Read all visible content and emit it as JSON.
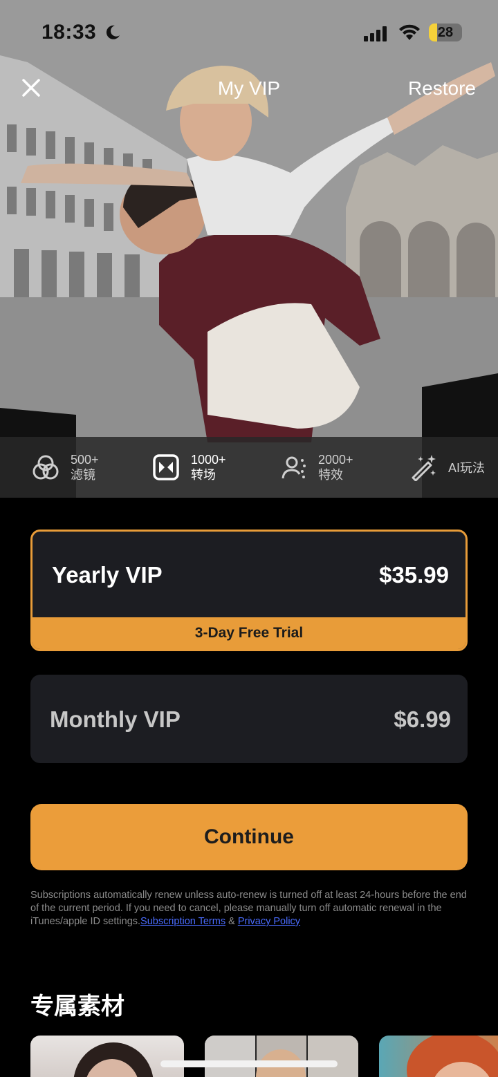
{
  "status_bar": {
    "time": "18:33",
    "battery": "28"
  },
  "nav": {
    "title": "My VIP",
    "restore": "Restore"
  },
  "features": [
    {
      "num": "500+",
      "text": "滤镜",
      "icon": "filter-icon"
    },
    {
      "num": "1000+",
      "text": "转场",
      "icon": "transition-icon"
    },
    {
      "num": "2000+",
      "text": "特效",
      "icon": "effects-icon"
    },
    {
      "text": "AI玩法",
      "icon": "magic-wand-icon"
    }
  ],
  "plans": {
    "yearly": {
      "name": "Yearly VIP",
      "price": "$35.99",
      "badge": "3-Day Free Trial"
    },
    "monthly": {
      "name": "Monthly VIP",
      "price": "$6.99"
    }
  },
  "continue_label": "Continue",
  "legal": {
    "text": "Subscriptions automatically renew unless auto-renew is turned off at least 24-hours before the end of the current period. If you need to cancel, please manually turn off automatic renewal in the iTunes/apple ID settings.",
    "terms": "Subscription Terms",
    "amp": " & ",
    "privacy": "Privacy Policy"
  },
  "section_title": "专属素材",
  "colors": {
    "accent": "#eb9d3a",
    "card": "#1c1d22",
    "link": "#4a6cff"
  }
}
